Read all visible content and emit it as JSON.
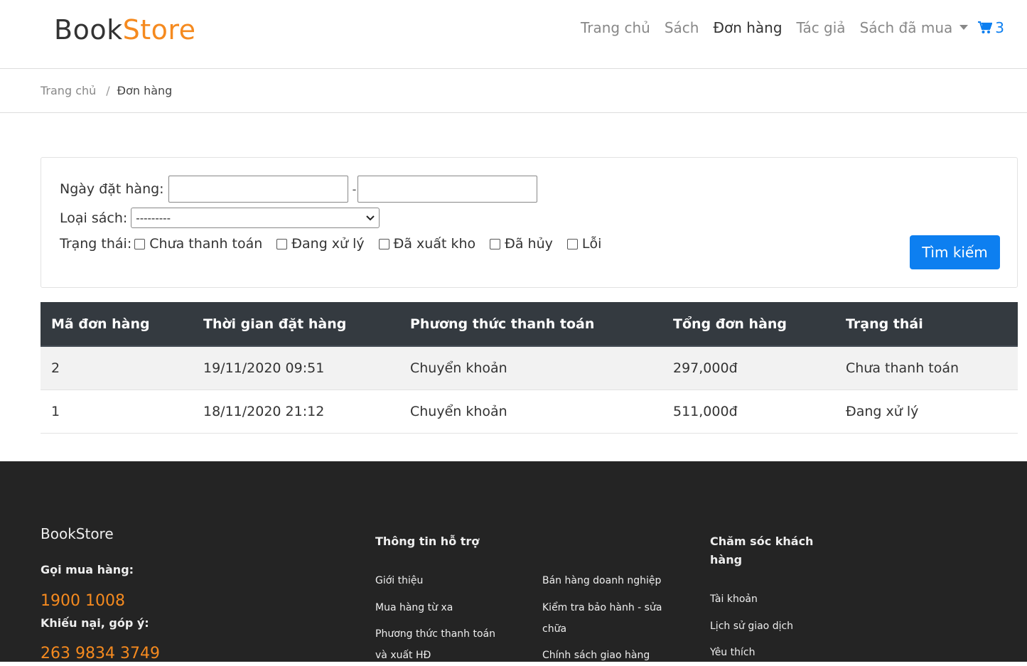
{
  "header": {
    "brand_part1": "Book",
    "brand_part2": "Store",
    "nav": {
      "home": "Trang chủ",
      "books": "Sách",
      "orders": "Đơn hàng",
      "authors": "Tác giả",
      "purchased": "Sách đã mua"
    },
    "cart_count": "3"
  },
  "breadcrumb": {
    "home": "Trang chủ",
    "separator": "/",
    "current": "Đơn hàng"
  },
  "filter": {
    "date_label": "Ngày đặt hàng:",
    "date_from": "",
    "date_to": "",
    "date_separator": "-",
    "category_label": "Loại sách:",
    "category_selected": "---------",
    "status_label": "Trạng thái:",
    "statuses": [
      "Chưa thanh toán",
      "Đang xử lý",
      "Đã xuất kho",
      "Đã hủy",
      "Lỗi"
    ],
    "search_button": "Tìm kiếm"
  },
  "table": {
    "headers": [
      "Mã đơn hàng",
      "Thời gian đặt hàng",
      "Phương thức thanh toán",
      "Tổng đơn hàng",
      "Trạng thái"
    ],
    "rows": [
      [
        "2",
        "19/11/2020 09:51",
        "Chuyển khoản",
        "297,000đ",
        "Chưa thanh toán"
      ],
      [
        "1",
        "18/11/2020 21:12",
        "Chuyển khoản",
        "511,000đ",
        "Đang xử lý"
      ]
    ]
  },
  "footer": {
    "brand": "BookStore",
    "call_label": "Gọi mua hàng:",
    "call_number": "1900 1008",
    "complaint_label": "Khiếu nại, góp ý:",
    "complaint_number": "263 9834 3749",
    "support_heading": "Thông tin hỗ trợ",
    "support_links_col1": [
      "Giới thiệu",
      "Mua hàng từ xa",
      "Phương thức thanh toán",
      "và xuất HĐ"
    ],
    "support_links_col2": [
      "Bán hàng doanh nghiệp",
      "Kiểm tra bảo hành - sửa",
      "chữa",
      "Chính sách giao hàng"
    ],
    "care_heading_line1": "Chăm sóc khách",
    "care_heading_line2": "hàng",
    "care_links": [
      "Tài khoản",
      "Lịch sử giao dịch",
      "Yêu thích"
    ]
  },
  "colors": {
    "accent": "#f58a1f",
    "primary": "#0d7ff0",
    "table_header_bg": "#343a40",
    "footer_bg": "#242424"
  }
}
